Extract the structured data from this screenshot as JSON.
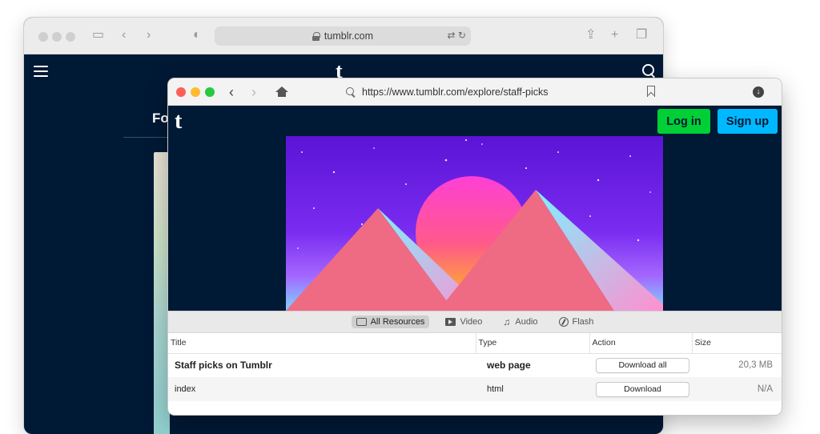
{
  "back_window": {
    "address": "tumblr.com",
    "heading_fragment": "Fo",
    "logo_letter": "t"
  },
  "front_window": {
    "url": "https://www.tumblr.com/explore/staff-picks",
    "logo_letter": "t",
    "login_label": "Log in",
    "signup_label": "Sign up",
    "colors": {
      "login": "#00cf35",
      "signup": "#00b8ff",
      "page_bg": "#001935"
    }
  },
  "filters": [
    {
      "label": "All Resources",
      "icon": "resources-icon",
      "active": true
    },
    {
      "label": "Video",
      "icon": "video-icon",
      "active": false
    },
    {
      "label": "Audio",
      "icon": "audio-icon",
      "active": false
    },
    {
      "label": "Flash",
      "icon": "flash-icon",
      "active": false
    }
  ],
  "table": {
    "columns": [
      "Title",
      "Type",
      "Action",
      "Size"
    ],
    "rows": [
      {
        "title": "Staff picks on Tumblr",
        "type": "web page",
        "action": "Download all",
        "size": "20,3 MB"
      },
      {
        "title": "index",
        "type": "html",
        "action": "Download",
        "size": "N/A"
      }
    ]
  }
}
